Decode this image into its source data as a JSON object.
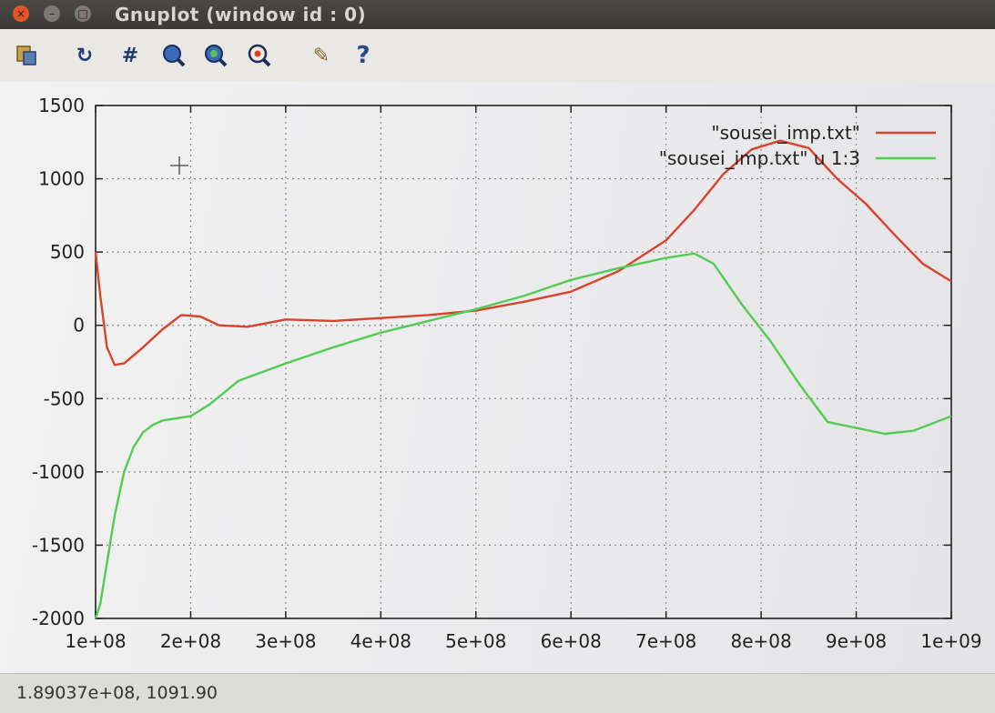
{
  "window": {
    "title": "Gnuplot (window id : 0)",
    "controls": {
      "close_glyph": "×",
      "minimize_glyph": "–",
      "maximize_glyph": "□"
    }
  },
  "toolbar": {
    "items": [
      {
        "name": "copy-to-clipboard-icon"
      },
      {
        "name": "replot-icon",
        "glyph": "↻"
      },
      {
        "name": "grid-icon",
        "glyph": "#"
      },
      {
        "name": "zoom-prev-icon"
      },
      {
        "name": "zoom-next-icon"
      },
      {
        "name": "zoom-autoscale-icon"
      },
      {
        "name": "settings-icon",
        "glyph": "✎"
      },
      {
        "name": "help-icon",
        "glyph": "?"
      }
    ]
  },
  "status": {
    "coords": "1.89037e+08, 1091.90"
  },
  "chart_data": {
    "type": "line",
    "xlim": [
      100000000,
      1000000000
    ],
    "ylim": [
      -2000,
      1500
    ],
    "grid": true,
    "legend_position": "top-right",
    "xticks": [
      "1e+08",
      "2e+08",
      "3e+08",
      "4e+08",
      "5e+08",
      "6e+08",
      "7e+08",
      "8e+08",
      "9e+08",
      "1e+09"
    ],
    "yticks": [
      "1500",
      "1000",
      "500",
      "0",
      "-500",
      "-1000",
      "-1500",
      "-2000"
    ],
    "series": [
      {
        "name": "\"sousei_imp.txt\"",
        "color": "#d8432e",
        "x": [
          100000000,
          105000000,
          112000000,
          120000000,
          130000000,
          150000000,
          170000000,
          190000000,
          210000000,
          230000000,
          260000000,
          300000000,
          350000000,
          400000000,
          450000000,
          500000000,
          550000000,
          600000000,
          650000000,
          700000000,
          730000000,
          760000000,
          790000000,
          820000000,
          850000000,
          880000000,
          910000000,
          940000000,
          970000000,
          1000000000
        ],
        "y": [
          500,
          200,
          -150,
          -270,
          -260,
          -150,
          -30,
          70,
          60,
          0,
          -10,
          40,
          30,
          50,
          70,
          100,
          160,
          230,
          370,
          580,
          790,
          1030,
          1200,
          1260,
          1210,
          1000,
          830,
          620,
          420,
          300
        ]
      },
      {
        "name": "\"sousei_imp.txt\" u 1:3",
        "color": "#52cc52",
        "x": [
          100000000,
          105000000,
          110000000,
          115000000,
          120000000,
          130000000,
          140000000,
          150000000,
          160000000,
          170000000,
          180000000,
          200000000,
          220000000,
          250000000,
          300000000,
          350000000,
          400000000,
          450000000,
          500000000,
          550000000,
          600000000,
          650000000,
          700000000,
          730000000,
          750000000,
          780000000,
          810000000,
          840000000,
          870000000,
          900000000,
          930000000,
          960000000,
          1000000000
        ],
        "y": [
          -2000,
          -1900,
          -1700,
          -1500,
          -1300,
          -1000,
          -830,
          -730,
          -680,
          -650,
          -640,
          -620,
          -540,
          -380,
          -260,
          -150,
          -50,
          30,
          110,
          200,
          310,
          390,
          460,
          490,
          420,
          140,
          -110,
          -400,
          -660,
          -700,
          -740,
          -720,
          -620
        ]
      }
    ]
  }
}
